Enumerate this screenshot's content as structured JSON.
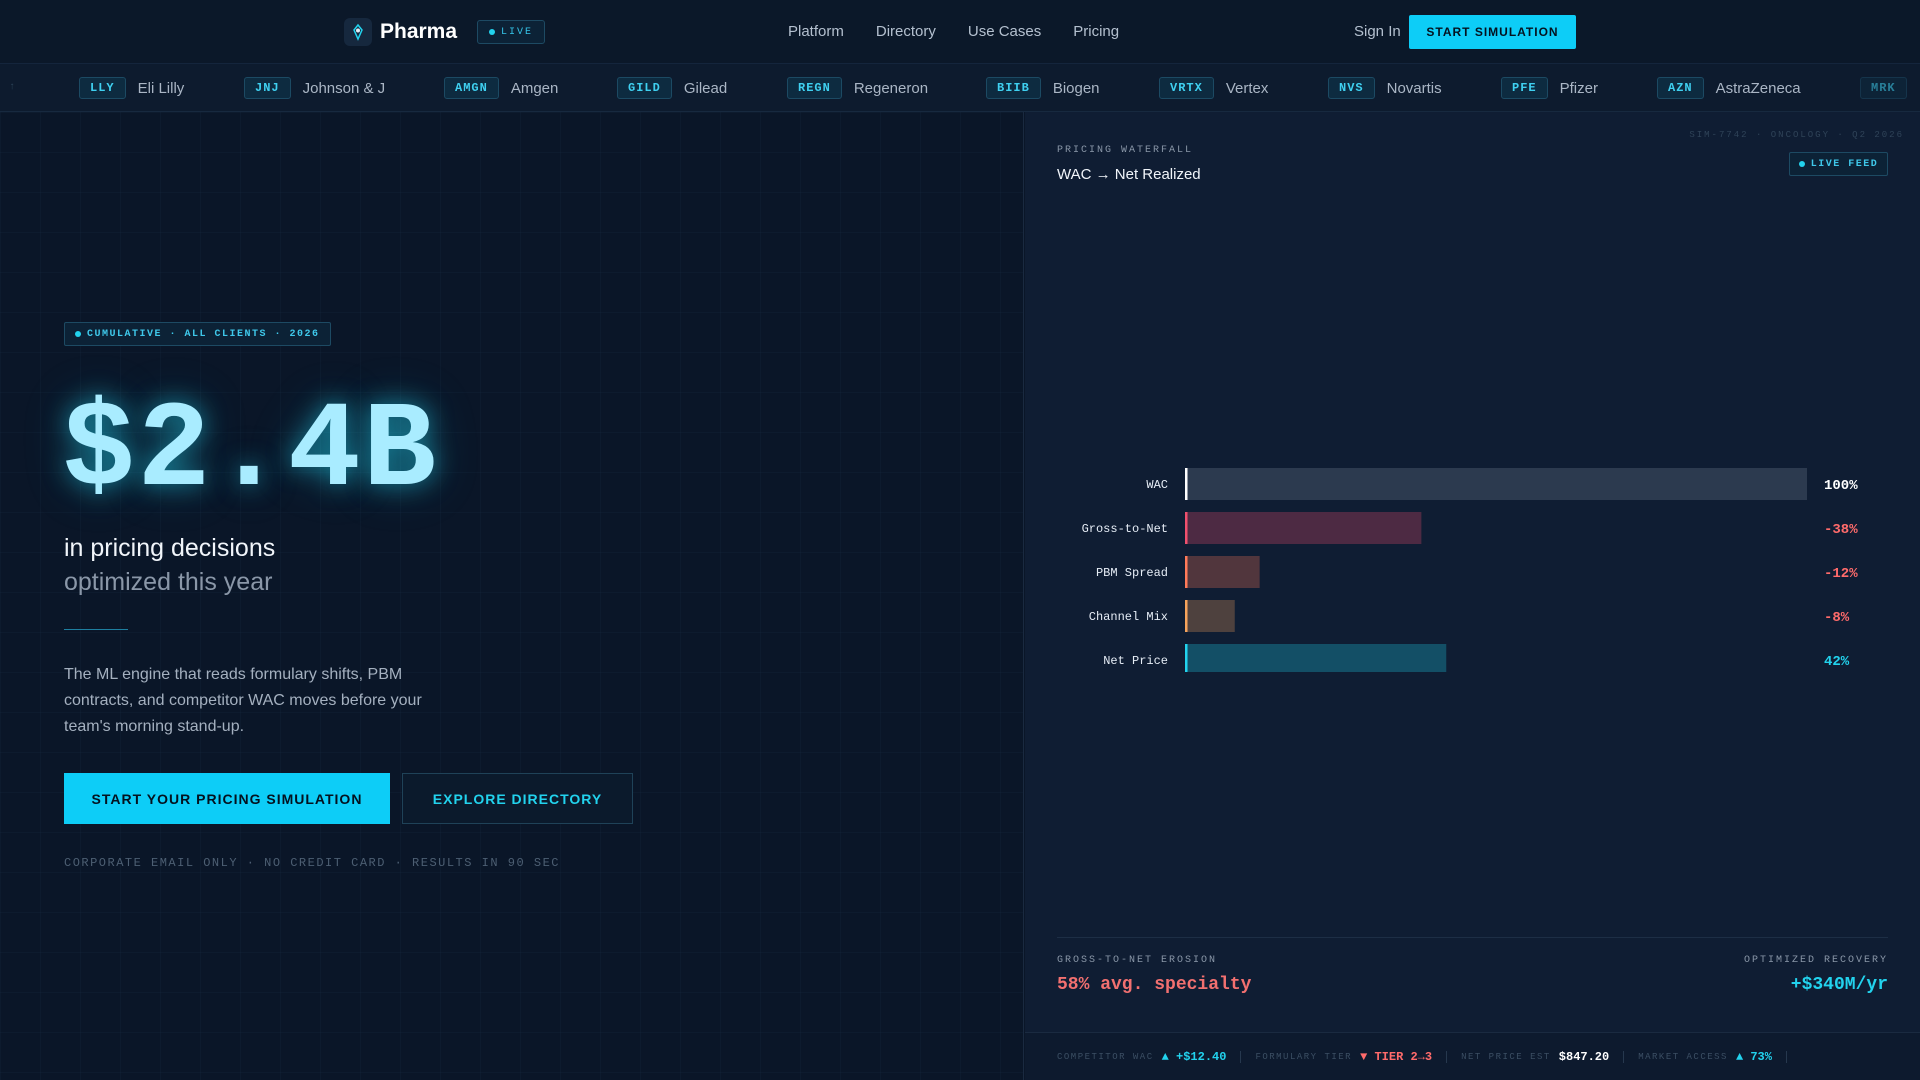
{
  "nav": {
    "brand": "Pharma",
    "live": "LIVE",
    "links": [
      "Platform",
      "Directory",
      "Use Cases",
      "Pricing"
    ],
    "sign_in": "Sign In",
    "start": "START SIMULATION"
  },
  "ticker": {
    "edge_left": "↑",
    "items": [
      {
        "sym": "LLY",
        "name": "Eli Lilly"
      },
      {
        "sym": "JNJ",
        "name": "Johnson & J"
      },
      {
        "sym": "AMGN",
        "name": "Amgen"
      },
      {
        "sym": "GILD",
        "name": "Gilead"
      },
      {
        "sym": "REGN",
        "name": "Regeneron"
      },
      {
        "sym": "BIIB",
        "name": "Biogen"
      },
      {
        "sym": "VRTX",
        "name": "Vertex"
      },
      {
        "sym": "NVS",
        "name": "Novartis"
      },
      {
        "sym": "PFE",
        "name": "Pfizer"
      },
      {
        "sym": "AZN",
        "name": "AstraZeneca"
      },
      {
        "sym": "MRK",
        "name": ""
      }
    ]
  },
  "hero": {
    "badge": "CUMULATIVE · ALL CLIENTS · 2026",
    "number": "$2.4B",
    "sub1": "in pricing decisions",
    "sub2": "optimized this year",
    "desc": "The ML engine that reads formulary shifts, PBM contracts, and competitor WAC moves before your team's morning stand-up.",
    "cta_primary": "START YOUR PRICING SIMULATION",
    "cta_secondary": "EXPLORE DIRECTORY",
    "fine": "CORPORATE EMAIL ONLY · NO CREDIT CARD · RESULTS IN 90 SEC"
  },
  "panel": {
    "sim_id": "SIM-7742 · ONCOLOGY · Q2 2026",
    "label": "PRICING WATERFALL",
    "title": "WAC → Net Realized",
    "live_feed": "LIVE FEED",
    "stat_left_label": "GROSS-TO-NET EROSION",
    "stat_left_value": "58% avg. specialty",
    "stat_right_label": "OPTIMIZED RECOVERY",
    "stat_right_value": "+$340M/yr"
  },
  "chart_data": {
    "type": "bar",
    "categories": [
      "WAC",
      "Gross-to-Net",
      "PBM Spread",
      "Channel Mix",
      "Net Price"
    ],
    "values": [
      100,
      -38,
      -12,
      -8,
      42
    ],
    "value_labels": [
      "100%",
      "-38%",
      "-12%",
      "-8%",
      "42%"
    ],
    "colors": [
      "#ffffff",
      "#f0506e",
      "#ff7a59",
      "#f5a35c",
      "#22d3ee"
    ],
    "label_colors": [
      "#ffffff",
      "#ff6b6b",
      "#ff6b6b",
      "#ff6b6b",
      "#22d3ee"
    ],
    "xlim": [
      0,
      100
    ]
  },
  "footer": [
    {
      "label": "COMPETITOR WAC",
      "value": "▲ +$12.40",
      "color": "#22d3ee"
    },
    {
      "label": "FORMULARY TIER",
      "value": "▼ TIER 2→3",
      "color": "#ff6b6b"
    },
    {
      "label": "NET PRICE EST",
      "value": "$847.20",
      "color": "#ffffff"
    },
    {
      "label": "MARKET ACCESS",
      "value": "▲ 73%",
      "color": "#22d3ee"
    }
  ]
}
